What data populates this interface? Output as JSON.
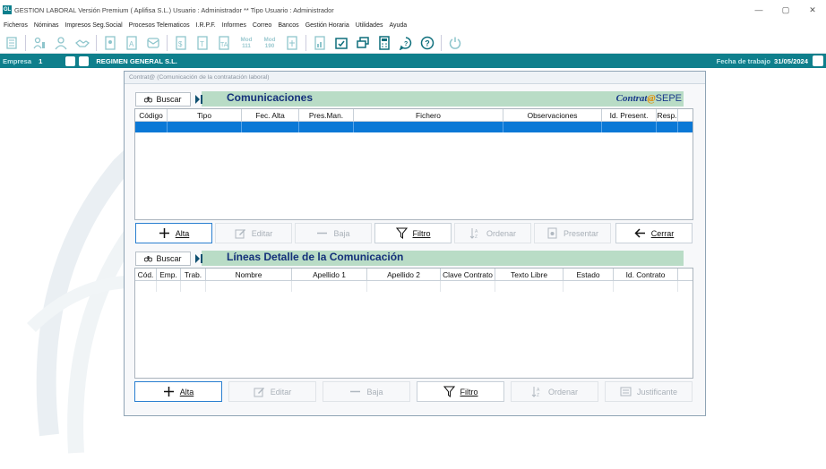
{
  "window": {
    "title": "GESTION LABORAL Versión Premium ( Aplifisa S.L.)   Usuario : Administrador  **  Tipo Usuario : Administrador",
    "logo": "GL",
    "controls": [
      "—",
      "▢",
      "✕"
    ]
  },
  "menu": [
    "Ficheros",
    "Nóminas",
    "Impresos Seg.Social",
    "Procesos Telematicos",
    "I.R.P.F.",
    "Informes",
    "Correo",
    "Bancos",
    "Gestión Horaria",
    "Utilidades",
    "Ayuda"
  ],
  "toolbar": {
    "mod111": "Mod\n111",
    "mod190": "Mod\n190"
  },
  "company_bar": {
    "empresa_label": "Empresa",
    "empresa_num": "1",
    "empresa_name": "REGIMEN GENERAL S.L.",
    "fecha_label": "Fecha de trabajo",
    "fecha_value": "31/05/2024"
  },
  "dialog": {
    "title": "Contrat@ (Comunicación de la contratación laboral)",
    "section1": {
      "buscar": "Buscar",
      "title": "Comunicaciones",
      "logo_contrat": "Contrat",
      "logo_at": "@",
      "logo_sepe": "SEPE",
      "columns": [
        "Código",
        "Tipo",
        "Fec. Alta",
        "Pres.Man.",
        "Fichero",
        "Observaciones",
        "Id. Present.",
        "Resp."
      ],
      "buttons": {
        "alta": "Alta",
        "editar": "Editar",
        "baja": "Baja",
        "filtro": "Filtro",
        "ordenar": "Ordenar",
        "presentar": "Presentar",
        "cerrar": "Cerrar"
      }
    },
    "section2": {
      "buscar": "Buscar",
      "title": "Líneas Detalle de la Comunicación",
      "columns": [
        "Cód.",
        "Emp.",
        "Trab.",
        "Nombre",
        "Apellido 1",
        "Apellido 2",
        "Clave Contrato",
        "Texto Libre",
        "Estado",
        "Id. Contrato"
      ],
      "buttons": {
        "alta": "Alta",
        "editar": "Editar",
        "baja": "Baja",
        "filtro": "Filtro",
        "ordenar": "Ordenar",
        "justificante": "Justificante"
      }
    }
  },
  "colors": {
    "accent": "#0f7f8c",
    "section_band": "#b9dcc6",
    "section_title": "#14307a",
    "selection": "#0a78d6"
  }
}
